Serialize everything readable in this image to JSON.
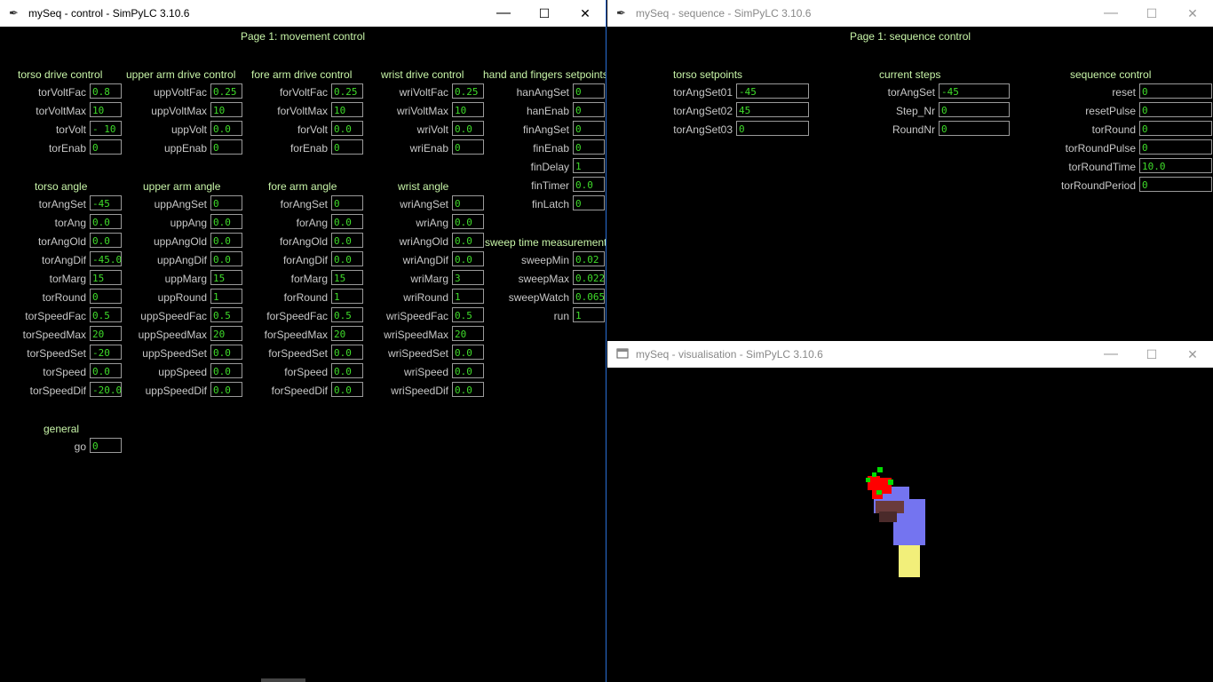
{
  "windows": {
    "control": {
      "title": "mySeq - control - SimPyLC 3.10.6",
      "page_title": "Page 1: movement control"
    },
    "sequence": {
      "title": "mySeq - sequence - SimPyLC 3.10.6",
      "page_title": "Page 1: sequence control"
    },
    "visualisation": {
      "title": "mySeq - visualisation - SimPyLC 3.10.6"
    }
  },
  "titlebar_buttons": {
    "minimize": "—",
    "maximize": "☐",
    "close": "✕"
  },
  "control": {
    "groups": [
      {
        "title": "torso drive control",
        "rows": [
          {
            "label": "torVoltFac",
            "value": "0.8"
          },
          {
            "label": "torVoltMax",
            "value": "10"
          },
          {
            "label": "torVolt",
            "value": "- 10"
          },
          {
            "label": "torEnab",
            "value": "0"
          }
        ]
      },
      {
        "title": "upper arm drive control",
        "rows": [
          {
            "label": "uppVoltFac",
            "value": "0.25"
          },
          {
            "label": "uppVoltMax",
            "value": "10"
          },
          {
            "label": "uppVolt",
            "value": "0.0"
          },
          {
            "label": "uppEnab",
            "value": "0"
          }
        ]
      },
      {
        "title": "fore arm drive control",
        "rows": [
          {
            "label": "forVoltFac",
            "value": "0.25"
          },
          {
            "label": "forVoltMax",
            "value": "10"
          },
          {
            "label": "forVolt",
            "value": "0.0"
          },
          {
            "label": "forEnab",
            "value": "0"
          }
        ]
      },
      {
        "title": "wrist drive control",
        "rows": [
          {
            "label": "wriVoltFac",
            "value": "0.25"
          },
          {
            "label": "wriVoltMax",
            "value": "10"
          },
          {
            "label": "wriVolt",
            "value": "0.0"
          },
          {
            "label": "wriEnab",
            "value": "0"
          }
        ]
      },
      {
        "title": "hand and fingers setpoints",
        "rows": [
          {
            "label": "hanAngSet",
            "value": "0"
          },
          {
            "label": "hanEnab",
            "value": "0"
          },
          {
            "label": "finAngSet",
            "value": "0"
          },
          {
            "label": "finEnab",
            "value": "0"
          },
          {
            "label": "finDelay",
            "value": "1"
          },
          {
            "label": "finTimer",
            "value": "0.0"
          },
          {
            "label": "finLatch",
            "value": "0"
          }
        ]
      },
      {
        "title": "torso angle",
        "rows": [
          {
            "label": "torAngSet",
            "value": "-45"
          },
          {
            "label": "torAng",
            "value": "0.0"
          },
          {
            "label": "torAngOld",
            "value": "0.0"
          },
          {
            "label": "torAngDif",
            "value": "-45.0"
          },
          {
            "label": "torMarg",
            "value": "15"
          },
          {
            "label": "torRound",
            "value": "0"
          },
          {
            "label": "torSpeedFac",
            "value": "0.5"
          },
          {
            "label": "torSpeedMax",
            "value": "20"
          },
          {
            "label": "torSpeedSet",
            "value": "-20"
          },
          {
            "label": "torSpeed",
            "value": "0.0"
          },
          {
            "label": "torSpeedDif",
            "value": "-20.0"
          }
        ]
      },
      {
        "title": "upper arm angle",
        "rows": [
          {
            "label": "uppAngSet",
            "value": "0"
          },
          {
            "label": "uppAng",
            "value": "0.0"
          },
          {
            "label": "uppAngOld",
            "value": "0.0"
          },
          {
            "label": "uppAngDif",
            "value": "0.0"
          },
          {
            "label": "uppMarg",
            "value": "15"
          },
          {
            "label": "uppRound",
            "value": "1"
          },
          {
            "label": "uppSpeedFac",
            "value": "0.5"
          },
          {
            "label": "uppSpeedMax",
            "value": "20"
          },
          {
            "label": "uppSpeedSet",
            "value": "0.0"
          },
          {
            "label": "uppSpeed",
            "value": "0.0"
          },
          {
            "label": "uppSpeedDif",
            "value": "0.0"
          }
        ]
      },
      {
        "title": "fore arm angle",
        "rows": [
          {
            "label": "forAngSet",
            "value": "0"
          },
          {
            "label": "forAng",
            "value": "0.0"
          },
          {
            "label": "forAngOld",
            "value": "0.0"
          },
          {
            "label": "forAngDif",
            "value": "0.0"
          },
          {
            "label": "forMarg",
            "value": "15"
          },
          {
            "label": "forRound",
            "value": "1"
          },
          {
            "label": "forSpeedFac",
            "value": "0.5"
          },
          {
            "label": "forSpeedMax",
            "value": "20"
          },
          {
            "label": "forSpeedSet",
            "value": "0.0"
          },
          {
            "label": "forSpeed",
            "value": "0.0"
          },
          {
            "label": "forSpeedDif",
            "value": "0.0"
          }
        ]
      },
      {
        "title": "wrist angle",
        "rows": [
          {
            "label": "wriAngSet",
            "value": "0"
          },
          {
            "label": "wriAng",
            "value": "0.0"
          },
          {
            "label": "wriAngOld",
            "value": "0.0"
          },
          {
            "label": "wriAngDif",
            "value": "0.0"
          },
          {
            "label": "wriMarg",
            "value": "3"
          },
          {
            "label": "wriRound",
            "value": "1"
          },
          {
            "label": "wriSpeedFac",
            "value": "0.5"
          },
          {
            "label": "wriSpeedMax",
            "value": "20"
          },
          {
            "label": "wriSpeedSet",
            "value": "0.0"
          },
          {
            "label": "wriSpeed",
            "value": "0.0"
          },
          {
            "label": "wriSpeedDif",
            "value": "0.0"
          }
        ]
      },
      {
        "title": "sweep time measurement",
        "rows": [
          {
            "label": "sweepMin",
            "value": "0.02"
          },
          {
            "label": "sweepMax",
            "value": "0.022"
          },
          {
            "label": "sweepWatch",
            "value": "0.065"
          },
          {
            "label": "run",
            "value": "1"
          }
        ]
      },
      {
        "title": "general",
        "rows": [
          {
            "label": "go",
            "value": "0"
          }
        ]
      }
    ]
  },
  "sequence": {
    "groups": [
      {
        "title": "torso setpoints",
        "rows": [
          {
            "label": "torAngSet01",
            "value": "-45"
          },
          {
            "label": "torAngSet02",
            "value": "45"
          },
          {
            "label": "torAngSet03",
            "value": "0"
          }
        ]
      },
      {
        "title": "current steps",
        "rows": [
          {
            "label": "torAngSet",
            "value": "-45"
          },
          {
            "label": "Step_Nr",
            "value": "0"
          },
          {
            "label": "RoundNr",
            "value": "0"
          }
        ]
      },
      {
        "title": "sequence control",
        "rows": [
          {
            "label": "reset",
            "value": "0"
          },
          {
            "label": "resetPulse",
            "value": "0"
          },
          {
            "label": "torRound",
            "value": "0"
          },
          {
            "label": "torRoundPulse",
            "value": "0"
          },
          {
            "label": "torRoundTime",
            "value": "10.0"
          },
          {
            "label": "torRoundPeriod",
            "value": "0"
          }
        ]
      }
    ]
  },
  "colors": {
    "background": "#000000",
    "group_title": "#c8f5a8",
    "label": "#c8c8c8",
    "value": "#3fdc2a",
    "field_border": "#9a9a9a",
    "robot_base": "#f2ef7a",
    "robot_torso": "#7474f0",
    "robot_joint": "#6a3b3b",
    "robot_fingers_red": "#ff0000",
    "robot_fingers_green": "#00dd00"
  },
  "icons": {
    "app": "feather-icon",
    "visualisation": "window-icon"
  }
}
